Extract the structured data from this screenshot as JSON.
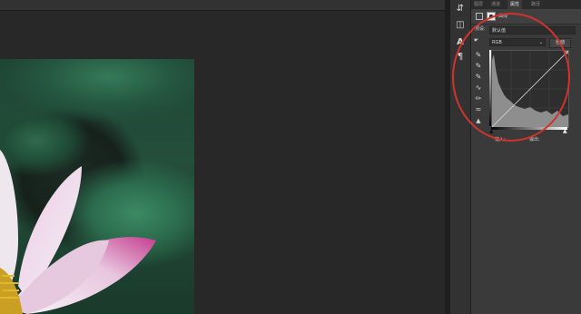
{
  "panel_tabs": [
    "图层",
    "通道",
    "属性",
    "路径"
  ],
  "properties": {
    "title": "曲线",
    "preset_label": "预设:",
    "preset_value": "默认值",
    "channel_value": "RGB",
    "auto_label": "自动",
    "input_label": "输入:",
    "output_label": "输出:"
  },
  "colors": {
    "annotation_ring": "#d0332e",
    "canvas_bg": "#282828",
    "panel_bg": "#3a3a3a"
  },
  "icons": {
    "toolstrip": [
      "adjustments-icon",
      "layers-icon",
      "character-icon",
      "paragraph-icon"
    ],
    "curve_tools": [
      "eyedropper-black-icon",
      "eyedropper-gray-icon",
      "eyedropper-white-icon",
      "curve-point-icon",
      "pencil-icon",
      "smooth-icon",
      "clipping-warning-icon"
    ]
  }
}
